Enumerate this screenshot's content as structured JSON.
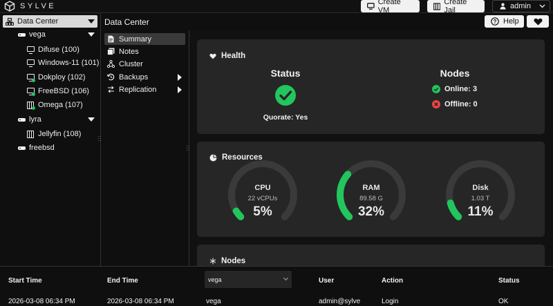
{
  "app": {
    "brand": "SYLVE"
  },
  "topbar": {
    "create_vm": "Create VM",
    "create_jail": "Create Jail",
    "user": "admin"
  },
  "tree": {
    "root": "Data Center",
    "nodes": [
      {
        "name": "vega",
        "items": [
          {
            "label": "Difuse (100)",
            "type": "vm",
            "running": false
          },
          {
            "label": "Windows-11 (101)",
            "type": "vm",
            "running": false
          },
          {
            "label": "Dokploy (102)",
            "type": "vm",
            "running": true
          },
          {
            "label": "FreeBSD (106)",
            "type": "vm",
            "running": true
          },
          {
            "label": "Omega (107)",
            "type": "jail",
            "running": true
          }
        ]
      },
      {
        "name": "lyra",
        "items": [
          {
            "label": "Jellyfin (108)",
            "type": "jail",
            "running": false
          }
        ]
      },
      {
        "name": "freebsd",
        "items": []
      }
    ]
  },
  "page": {
    "title": "Data Center"
  },
  "menu": {
    "items": [
      {
        "label": "Summary",
        "active": true
      },
      {
        "label": "Notes"
      },
      {
        "label": "Cluster"
      },
      {
        "label": "Backups",
        "submenu": true
      },
      {
        "label": "Replication",
        "submenu": true
      }
    ]
  },
  "actions": {
    "help": "Help"
  },
  "health": {
    "title": "Health",
    "status_title": "Status",
    "quorate": "Quorate: Yes",
    "nodes_title": "Nodes",
    "online": "Online: 3",
    "offline": "Offline: 0"
  },
  "resources": {
    "title": "Resources",
    "gauges": [
      {
        "name": "CPU",
        "sub": "22 vCPUs",
        "value": "5%",
        "percent": 5
      },
      {
        "name": "RAM",
        "sub": "89.58 G",
        "value": "32%",
        "percent": 32
      },
      {
        "name": "Disk",
        "sub": "1.03 T",
        "value": "11%",
        "percent": 11
      }
    ]
  },
  "nodes_card": {
    "title": "Nodes"
  },
  "colors": {
    "green": "#22c55e",
    "red": "#ef4444",
    "track": "#3a3a3a"
  },
  "tasks": {
    "headers": [
      "Start Time",
      "End Time",
      "",
      "User",
      "Action",
      "Status"
    ],
    "node_filter": "vega",
    "row": [
      "2026-03-08 06:34 PM",
      "2026-03-08 06:34 PM",
      "vega",
      "admin@sylve",
      "Login",
      "OK"
    ]
  }
}
